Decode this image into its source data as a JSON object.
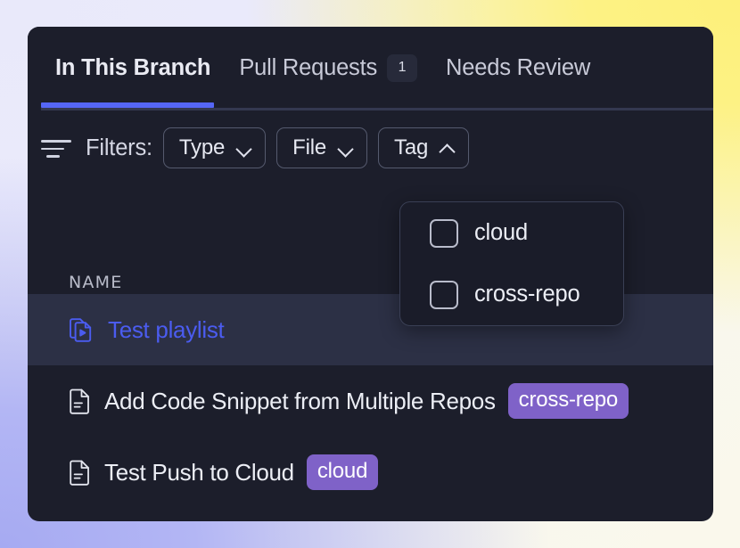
{
  "window": {
    "panel_bg": "#1c1e2b",
    "accent": "#5566f6",
    "tag_badge_color": "#7f62c8"
  },
  "tabs": [
    {
      "label": "In This Branch",
      "active": true,
      "badge": null
    },
    {
      "label": "Pull Requests",
      "active": false,
      "badge": "1"
    },
    {
      "label": "Needs Review",
      "active": false,
      "badge": null
    }
  ],
  "filters": {
    "icon": "filter-icon",
    "label": "Filters:",
    "buttons": [
      {
        "label": "Type",
        "chevron": "chevron-down-icon",
        "expanded": false
      },
      {
        "label": "File",
        "chevron": "chevron-down-icon",
        "expanded": false
      },
      {
        "label": "Tag",
        "chevron": "chevron-up-icon",
        "expanded": true
      }
    ]
  },
  "tag_dropdown": {
    "open": true,
    "options": [
      {
        "label": "cloud",
        "checked": false
      },
      {
        "label": "cross-repo",
        "checked": false
      }
    ]
  },
  "table": {
    "columns": [
      "NAME"
    ],
    "rows": [
      {
        "icon": "playlist-icon",
        "name": "Test playlist",
        "tag": null,
        "highlighted": true
      },
      {
        "icon": "document-icon",
        "name": "Add Code Snippet from Multiple Repos",
        "tag": "cross-repo",
        "highlighted": false
      },
      {
        "icon": "document-icon",
        "name": "Test Push to Cloud",
        "tag": "cloud",
        "highlighted": false
      }
    ]
  }
}
